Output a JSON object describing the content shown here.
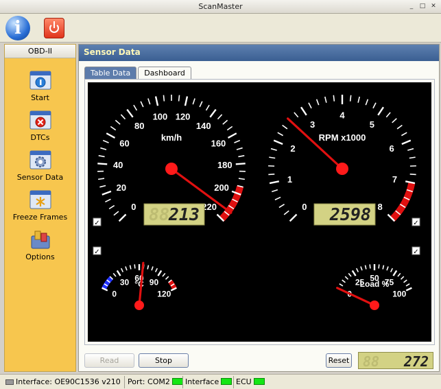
{
  "window": {
    "title": "ScanMaster",
    "controls": [
      "_",
      "□",
      "✕"
    ]
  },
  "toolbar": {
    "info_icon": "info-icon",
    "power_icon": "power-icon",
    "info_glyph": "i"
  },
  "sidebar": {
    "header": "OBD-II",
    "items": [
      {
        "label": "Start",
        "icon": "start-icon"
      },
      {
        "label": "DTCs",
        "icon": "dtcs-icon"
      },
      {
        "label": "Sensor Data",
        "icon": "sensor-data-icon"
      },
      {
        "label": "Freeze Frames",
        "icon": "freeze-frames-icon"
      },
      {
        "label": "Options",
        "icon": "options-icon"
      }
    ]
  },
  "main": {
    "header": "Sensor Data",
    "tabs": [
      {
        "label": "Table Data",
        "active": false
      },
      {
        "label": "Dashboard",
        "active": true
      }
    ]
  },
  "dashboard": {
    "speed": {
      "unit": "km/h",
      "value": 213,
      "max": 220,
      "display": "213",
      "ghost": "88",
      "ticks": [
        "0",
        "20",
        "40",
        "60",
        "80",
        "100",
        "120",
        "140",
        "160",
        "180",
        "200",
        "220"
      ]
    },
    "rpm": {
      "unit": "RPM x1000",
      "value": 2.598,
      "max": 8,
      "display": "2598",
      "ticks": [
        "0",
        "1",
        "2",
        "3",
        "4",
        "5",
        "6",
        "7",
        "8"
      ]
    },
    "temp": {
      "unit": "°C",
      "value": 65,
      "max": 120,
      "ticks": [
        "0",
        "30",
        "60",
        "90",
        "120"
      ]
    },
    "load": {
      "unit": "Load %",
      "value": 0,
      "max": 100,
      "ticks": [
        "0",
        "25",
        "50",
        "75",
        "100"
      ]
    },
    "colors": {
      "needle": "#e01010",
      "hub": "#ff1a1a",
      "lcd_bg": "#d3d284",
      "lcd_text": "#222222",
      "cold": "#2233ff"
    },
    "checkbox_mark": "✓"
  },
  "buttons": {
    "read": "Read",
    "stop": "Stop",
    "reset": "Reset"
  },
  "counter": {
    "value": "272",
    "ghost": "88"
  },
  "statusbar": {
    "interface_label": "Interface: OE90C1536 v210",
    "port_label": "Port: COM2",
    "interface_status": "Interface",
    "ecu_label": "ECU"
  }
}
